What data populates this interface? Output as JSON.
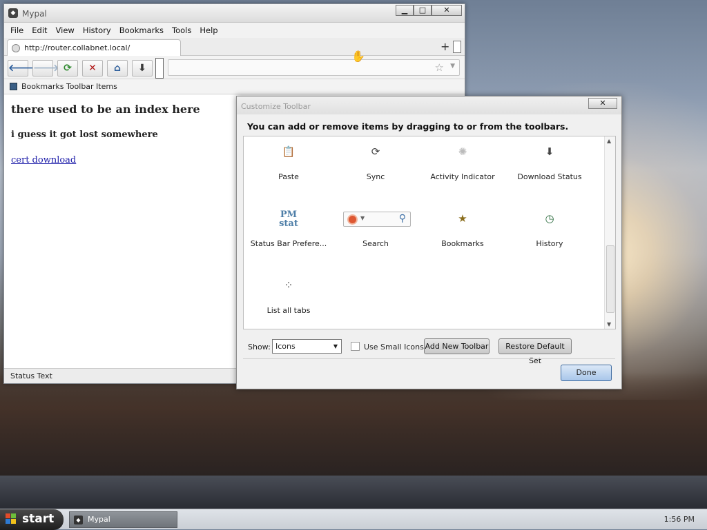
{
  "browser": {
    "title": "Mypal",
    "window_buttons": {
      "minimize": "▁",
      "maximize": "□",
      "close": "✕"
    },
    "menu": [
      "File",
      "Edit",
      "View",
      "History",
      "Bookmarks",
      "Tools",
      "Help"
    ],
    "tab": {
      "url": "http://router.collabnet.local/"
    },
    "new_tab": "+",
    "bookmarks_toolbar_label": "Bookmarks Toolbar Items",
    "page": {
      "heading": "there used to be an index here",
      "subheading": "i guess it got lost somewhere",
      "link": "cert download"
    },
    "status": "Status Text"
  },
  "dialog": {
    "title": "Customize Toolbar",
    "instructions": "You can add or remove items by dragging to or from the toolbars.",
    "items": [
      {
        "label": "Paste",
        "icon": "paste-icon",
        "glyph": "📋"
      },
      {
        "label": "Sync",
        "icon": "sync-icon",
        "glyph": "⟳"
      },
      {
        "label": "Activity Indicator",
        "icon": "activity-indicator-icon",
        "glyph": "✺"
      },
      {
        "label": "Download Status",
        "icon": "download-status-icon",
        "glyph": "⬇"
      },
      {
        "label": "Status Bar Prefere...",
        "icon": "status-bar-preferences-icon",
        "pm1": "PM",
        "pm2": "stat"
      },
      {
        "label": "Search",
        "icon": "search-icon"
      },
      {
        "label": "Bookmarks",
        "icon": "bookmarks-icon",
        "glyph": "★"
      },
      {
        "label": "History",
        "icon": "history-icon",
        "glyph": "◷"
      },
      {
        "label": "List all tabs",
        "icon": "list-all-tabs-icon",
        "glyph": "⁘"
      }
    ],
    "show_label": "Show:",
    "show_value": "Icons",
    "small_icons_label": "Use Small Icons",
    "add_toolbar": "Add New Toolbar",
    "restore_default": "Restore Default Set",
    "done": "Done",
    "close": "✕"
  },
  "taskbar": {
    "start": "start",
    "task": "Mypal",
    "clock": "1:56 PM"
  }
}
